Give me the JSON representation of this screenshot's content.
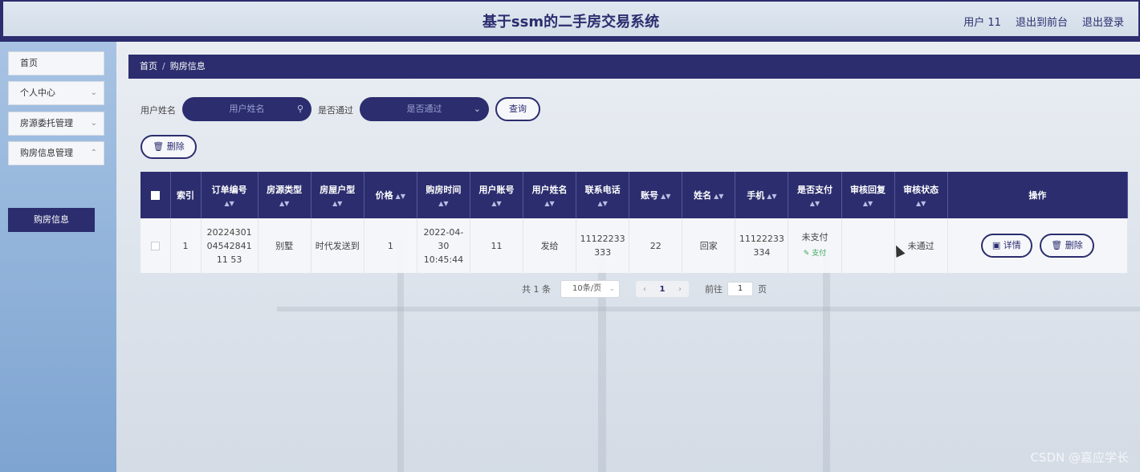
{
  "header": {
    "title": "基于ssm的二手房交易系统",
    "user": "用户 11",
    "back_front": "退出到前台",
    "logout": "退出登录"
  },
  "sidebar": {
    "items": [
      {
        "label": "首页"
      },
      {
        "label": "个人中心"
      },
      {
        "label": "房源委托管理"
      },
      {
        "label": "购房信息管理"
      }
    ],
    "active_sub": "购房信息"
  },
  "breadcrumb": {
    "home": "首页",
    "sep": "/",
    "current": "购房信息"
  },
  "search": {
    "name_label": "用户姓名",
    "name_placeholder": "用户姓名",
    "pass_label": "是否通过",
    "pass_placeholder": "是否通过",
    "query_button": "查询"
  },
  "toolbar": {
    "delete_button": "删除"
  },
  "table": {
    "headers": [
      "索引",
      "订单编号",
      "房源类型",
      "房屋户型",
      "价格",
      "购房时间",
      "用户账号",
      "用户姓名",
      "联系电话",
      "账号",
      "姓名",
      "手机",
      "是否支付",
      "审核回复",
      "审核状态",
      "操作"
    ],
    "row": {
      "index": "1",
      "order_no": "202243010454284111 53",
      "type": "别墅",
      "layout": "时代发送到",
      "price": "1",
      "time": "2022-04-30 10:45:44",
      "account": "11",
      "user_name": "发给",
      "phone": "11122233333",
      "acct": "22",
      "name": "回家",
      "mobile": "11122233334",
      "paid": "未支付",
      "pay_link": "支付",
      "reply": "",
      "status": "未通过",
      "detail_btn": "详情",
      "delete_btn": "删除"
    }
  },
  "pagination": {
    "total": "共 1 条",
    "page_size": "10条/页",
    "current": "1",
    "goto_label": "前往",
    "goto_value": "1",
    "page_suffix": "页"
  },
  "watermark": "CSDN @嘉应学长"
}
